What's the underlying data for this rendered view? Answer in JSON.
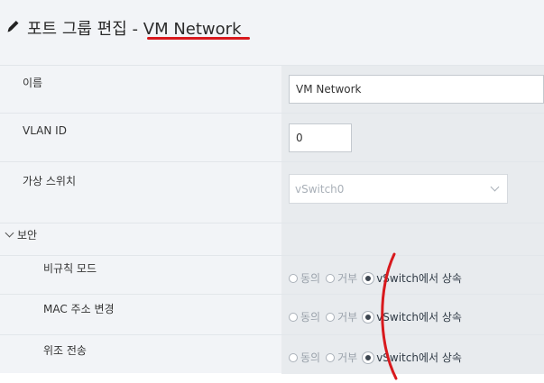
{
  "header": {
    "title_prefix": "포트 그룹 편집",
    "title_sep": " - ",
    "title_name": "VM Network"
  },
  "fields": {
    "name": {
      "label": "이름",
      "value": "VM Network"
    },
    "vlan": {
      "label": "VLAN ID",
      "value": "0"
    },
    "vswitch": {
      "label": "가상 스위치",
      "value": "vSwitch0"
    }
  },
  "security": {
    "section_label": "보안",
    "options": {
      "accept": "동의",
      "reject": "거부",
      "inherit": "vSwitch에서 상속"
    },
    "rows": [
      {
        "label": "비규칙 모드",
        "selected": "inherit"
      },
      {
        "label": "MAC 주소 변경",
        "selected": "inherit"
      },
      {
        "label": "위조 전송",
        "selected": "inherit"
      }
    ]
  },
  "colors": {
    "annotation": "#d8191d",
    "panel_bg": "#f2f4f7",
    "value_bg": "#e8ebee"
  },
  "icons": {
    "edit": "pencil-icon",
    "expand": "chevron-down-icon"
  }
}
